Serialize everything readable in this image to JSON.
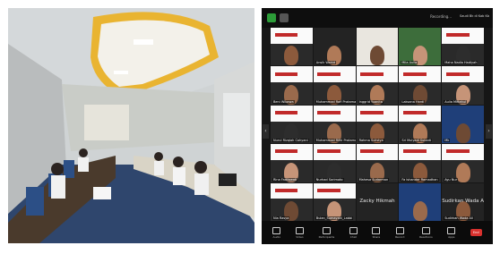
{
  "left_photo": {
    "subject": "meeting-room-participants"
  },
  "conference": {
    "status_text": "Recording...",
    "host_text": "Saudi Bk di Kab Kb",
    "tiles": [
      {
        "name": "",
        "bigname": "",
        "style": "slide"
      },
      {
        "name": "Ansik Wahid",
        "bigname": "",
        "style": "dark"
      },
      {
        "name": "",
        "bigname": "",
        "style": "light"
      },
      {
        "name": "Mila Aulia",
        "bigname": "",
        "style": "green"
      },
      {
        "name": "Maha Nadia Hadiyah",
        "bigname": "",
        "style": "slide"
      },
      {
        "name": "Beni Wibawa",
        "bigname": "",
        "style": "slide"
      },
      {
        "name": "Muhammad Rafi Pratama",
        "bigname": "",
        "style": "slide"
      },
      {
        "name": "Inggrid Yuanita",
        "bigname": "",
        "style": "slide"
      },
      {
        "name": "Laksana Hardi",
        "bigname": "",
        "style": "slide"
      },
      {
        "name": "Aulia Miftahul",
        "bigname": "",
        "style": "slide"
      },
      {
        "name": "Nurul Rizqiah Cahyani",
        "bigname": "",
        "style": "slide"
      },
      {
        "name": "Muhammad Rifki Pratama",
        "bigname": "",
        "style": "slide"
      },
      {
        "name": "Rahma Sulistya",
        "bigname": "",
        "style": "slide"
      },
      {
        "name": "Sri Mulyadi Sutanti",
        "bigname": "",
        "style": "slide"
      },
      {
        "name": "Mk",
        "bigname": "",
        "style": "blue"
      },
      {
        "name": "Rina Fadilawati",
        "bigname": "",
        "style": "slide"
      },
      {
        "name": "Nurhad Sorimoto",
        "bigname": "",
        "style": "slide"
      },
      {
        "name": "Mahesa Sudarman",
        "bigname": "",
        "style": "slide"
      },
      {
        "name": "Fa Ishandar Ramadhan",
        "bigname": "",
        "style": "slide"
      },
      {
        "name": "Ayu Nur",
        "bigname": "",
        "style": "slide"
      },
      {
        "name": "Nia Rasya",
        "bigname": "",
        "style": "slide"
      },
      {
        "name": "Bulan_Sumayani_Labbi",
        "bigname": "",
        "style": "slide"
      },
      {
        "name": "",
        "bigname": "Zacky Hikmah",
        "style": "dark"
      },
      {
        "name": "",
        "bigname": "",
        "style": "blue"
      },
      {
        "name": "Sudirkan Wada Ali",
        "bigname": "Sudirkan Wada Ali",
        "style": "dark"
      }
    ],
    "toolbar": [
      "Audio",
      "Video",
      "Participants",
      "Chat",
      "Share",
      "Record",
      "Reactions",
      "Apps",
      "End"
    ]
  }
}
